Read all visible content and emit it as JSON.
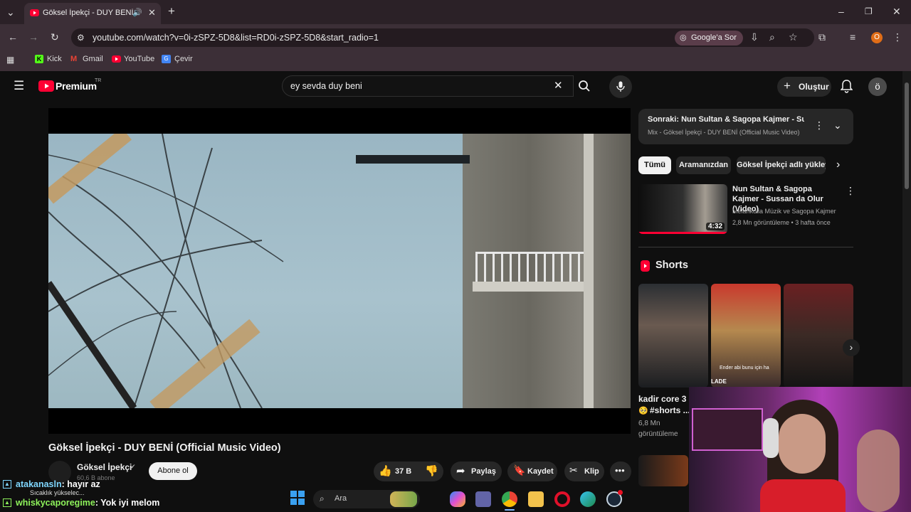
{
  "browser": {
    "tab_title": "Göksel İpekçi - DUY BENİ (O",
    "url": "youtube.com/watch?v=0i-zSPZ-5D8&list=RD0i-zSPZ-5D8&start_radio=1",
    "ask_google": "Google'a Sor",
    "profile_initial": "O",
    "bookmarks": [
      "Kick",
      "Gmail",
      "YouTube",
      "Çevir"
    ]
  },
  "youtube": {
    "brand": "Premium",
    "region": "TR",
    "search_query": "ey sevda duy beni",
    "create_label": "Oluştur",
    "account_initial": "ö"
  },
  "video": {
    "title": "Göksel İpekçi - DUY BENİ (Official Music Video)",
    "channel": "Göksel İpekçi",
    "subscribers": "60,6 B abone",
    "subscribe_label": "Abone ol",
    "likes": "37 B",
    "share_label": "Paylaş",
    "save_label": "Kaydet",
    "clip_label": "Klip"
  },
  "sidebar": {
    "up_next_title": "Sonraki: Nun Sultan & Sagopa Kajmer - Suss...",
    "up_next_sub": "Mix - Göksel İpekçi - DUY BENİ (Official Music Video)",
    "chips": [
      "Tümü",
      "Aramanızdan",
      "Göksel İpekçi adlı yükleyici"
    ],
    "recommendation": {
      "title": "Nun Sultan & Sagopa Kajmer - Sussan da Olur (Video)",
      "channel": "Melankolia Müzik ve Sagopa Kajmer",
      "meta": "2,8 Mn görüntüleme • 3 hafta önce",
      "duration": "4:32"
    },
    "shorts_heading": "Shorts",
    "short_caption_1": "kadir core 3",
    "short_caption_2": "#shorts ...",
    "short_views": "6,8 Mn",
    "short_views_label": "görüntüleme",
    "short_overlay_text": "Ender abi bunu için ha",
    "short_overlay_tag": "LADE"
  },
  "chat": {
    "lines": [
      {
        "user": "atakanasln",
        "message": ": hayır az"
      },
      {
        "user": "whiskycaporegime",
        "message": ": Yok iyi melom"
      }
    ],
    "weather": "Sıcaklık yükselec..."
  },
  "taskbar": {
    "search_label": "Ara"
  }
}
